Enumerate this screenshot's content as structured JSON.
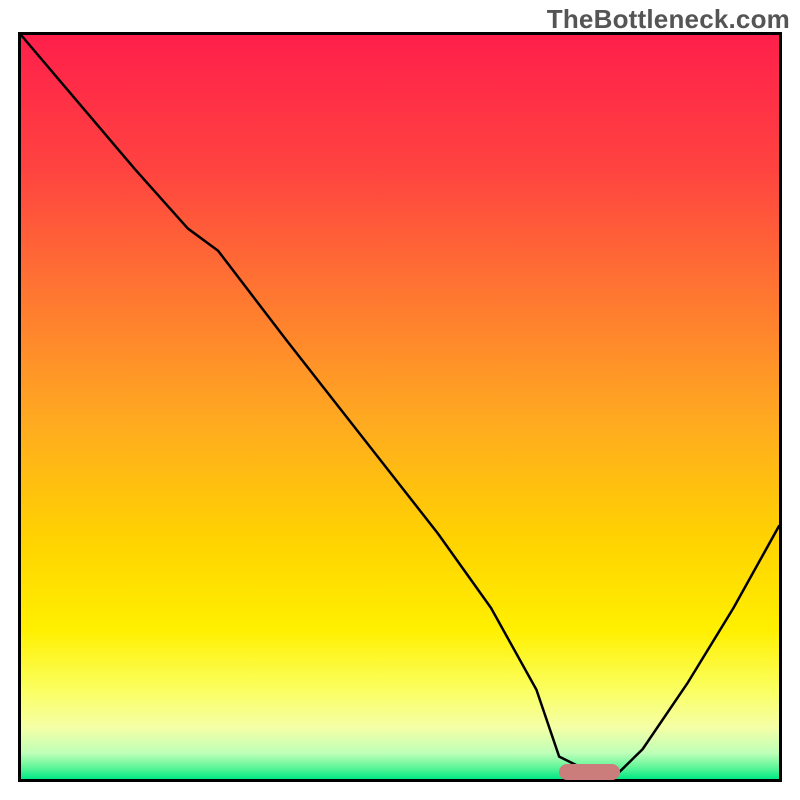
{
  "watermark": "TheBottleneck.com",
  "chart_data": {
    "type": "line",
    "title": "",
    "xlabel": "",
    "ylabel": "",
    "xlim": [
      0,
      100
    ],
    "ylim": [
      0,
      100
    ],
    "marker_x_range": [
      71,
      79
    ],
    "marker_y": 1,
    "series": [
      {
        "name": "curve",
        "x": [
          0,
          5,
          15,
          22,
          26,
          35,
          45,
          55,
          62,
          68,
          71,
          75,
          79,
          82,
          88,
          94,
          100
        ],
        "y": [
          100,
          94,
          82,
          74,
          71,
          59,
          46,
          33,
          23,
          12,
          3,
          1,
          1,
          4,
          13,
          23,
          34
        ]
      }
    ],
    "gradient_stops": [
      {
        "offset": 0.0,
        "color": "#ff1f4b"
      },
      {
        "offset": 0.18,
        "color": "#ff4340"
      },
      {
        "offset": 0.36,
        "color": "#ff7a30"
      },
      {
        "offset": 0.52,
        "color": "#ffaa20"
      },
      {
        "offset": 0.68,
        "color": "#ffd300"
      },
      {
        "offset": 0.8,
        "color": "#fff000"
      },
      {
        "offset": 0.88,
        "color": "#fbff60"
      },
      {
        "offset": 0.93,
        "color": "#f5ffa6"
      },
      {
        "offset": 0.965,
        "color": "#bfffb8"
      },
      {
        "offset": 0.985,
        "color": "#5cf598"
      },
      {
        "offset": 1.0,
        "color": "#00e884"
      }
    ]
  }
}
